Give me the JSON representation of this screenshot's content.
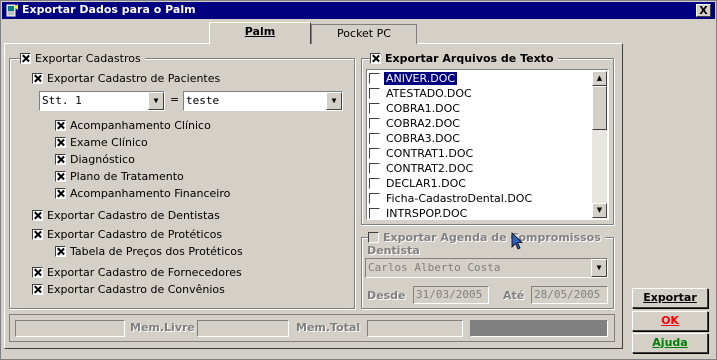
{
  "window": {
    "title": "Exportar Dados para o Palm",
    "close_label": "X"
  },
  "tabs": [
    {
      "label": "Palm",
      "active": true
    },
    {
      "label": "Pocket PC",
      "active": false
    }
  ],
  "cadastros": {
    "group_label": "Exportar Cadastros",
    "pacientes_label": "Exportar Cadastro de Pacientes",
    "filter_field": "Stt. 1",
    "filter_operator": "=",
    "filter_value": "teste",
    "sub_items": [
      "Acompanhamento Clínico",
      "Exame Clínico",
      "Diagnóstico",
      "Plano de Tratamento",
      "Acompanhamento Financeiro"
    ],
    "dentistas_label": "Exportar Cadastro de Dentistas",
    "proteticos_label": "Exportar Cadastro de Protéticos",
    "tabela_precos_label": "Tabela de Preços dos Protéticos",
    "fornecedores_label": "Exportar Cadastro de Fornecedores",
    "convenios_label": "Exportar Cadastro de Convênios"
  },
  "arquivos": {
    "group_label": "Exportar Arquivos de Texto",
    "files": [
      "ANIVER.DOC",
      "ATESTADO.DOC",
      "COBRA1.DOC",
      "COBRA2.DOC",
      "COBRA3.DOC",
      "CONTRAT1.DOC",
      "CONTRAT2.DOC",
      "DECLAR1.DOC",
      "Ficha-CadastroDental.DOC",
      "INTRSPOP.DOC"
    ],
    "selected_file": "ANIVER.DOC"
  },
  "agenda": {
    "group_label": "Exportar Agenda de Compromissos",
    "dentista_label": "Dentista",
    "dentista_value": "Carlos Alberto Costa",
    "desde_label": "Desde",
    "desde_value": "31/03/2005",
    "ate_label": "Até",
    "ate_value": "28/05/2005"
  },
  "status_bar": {
    "mem_livre_label": "Mem.Livre",
    "mem_total_label": "Mem.Total"
  },
  "buttons": {
    "exportar": "Exportar",
    "ok": "OK",
    "ajuda": "Ajuda"
  },
  "colors": {
    "titlebar": "#000080",
    "face": "#d4d0c8",
    "ok_text": "#ff0000",
    "ajuda_text": "#008000"
  }
}
